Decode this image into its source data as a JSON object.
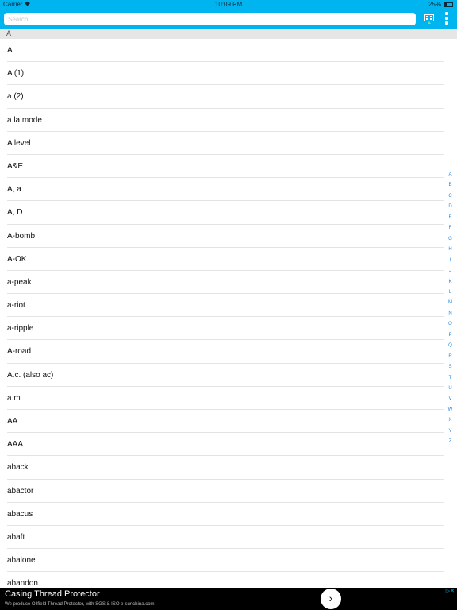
{
  "status_bar": {
    "carrier": "Carrier",
    "wifi_icon": "wifi-icon",
    "time": "10:09 PM",
    "battery": "25%"
  },
  "search": {
    "placeholder": "Search"
  },
  "section_header": "A",
  "words": [
    "A",
    "A (1)",
    "a (2)",
    "a la mode",
    "A level",
    "A&E",
    "A, a",
    "A, D",
    "A-bomb",
    "A-OK",
    "a-peak",
    "a-riot",
    "a-ripple",
    "A-road",
    "A.c. (also ac)",
    "a.m",
    "AA",
    "AAA",
    "aback",
    "abactor",
    "abacus",
    "abaft",
    "abalone",
    "abandon"
  ],
  "index_letters": [
    "A",
    "B",
    "C",
    "D",
    "E",
    "F",
    "G",
    "H",
    "I",
    "J",
    "K",
    "L",
    "M",
    "N",
    "O",
    "P",
    "Q",
    "R",
    "S",
    "T",
    "U",
    "V",
    "W",
    "X",
    "Y",
    "Z"
  ],
  "ad": {
    "title": "Casing Thread Protector",
    "subtitle": "We produce Oilfield Thread Protector, with SGS & ISO e-sunchina.com",
    "go_symbol": "›",
    "adchoices_symbol": "▷✕"
  },
  "colors": {
    "accent": "#00b4f0",
    "index_letter": "#1e88e5",
    "ad_background": "#000000"
  },
  "icons": {
    "toolbar_left": "flashcard-grid-icon",
    "toolbar_right": "more-vertical-icon"
  }
}
